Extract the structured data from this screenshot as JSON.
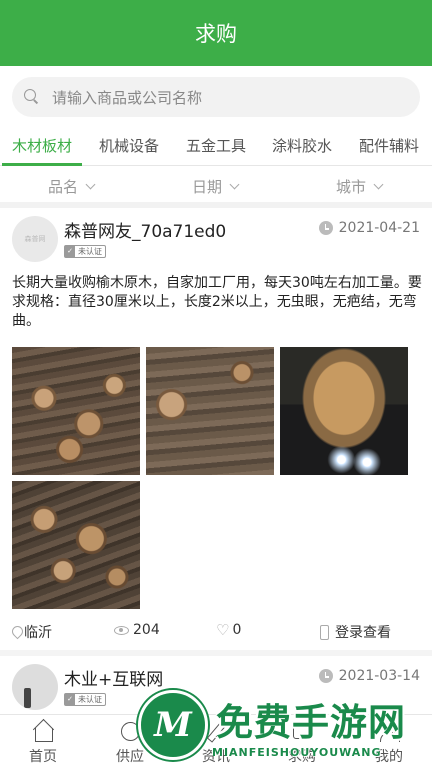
{
  "header": {
    "title": "求购"
  },
  "search": {
    "placeholder": "请输入商品或公司名称"
  },
  "tabs": [
    {
      "label": "木材板材",
      "active": true
    },
    {
      "label": "机械设备"
    },
    {
      "label": "五金工具"
    },
    {
      "label": "涂料胶水"
    },
    {
      "label": "配件辅料"
    }
  ],
  "filters": [
    {
      "label": "品名"
    },
    {
      "label": "日期"
    },
    {
      "label": "城市"
    }
  ],
  "posts": [
    {
      "username": "森普网友_70a71ed0",
      "avatar_text": "森普网",
      "badge": "未认证",
      "date": "2021-04-21",
      "description": "长期大量收购榆木原木，自家加工厂用，每天30吨左右加工量。要求规格：直径30厘米以上，长度2米以上，无虫眼，无疤结，无弯曲。",
      "location": "临沂",
      "views": "204",
      "likes": "0",
      "contact": "登录查看"
    },
    {
      "username": "木业+互联网",
      "badge": "未认证",
      "date": "2021-03-14"
    }
  ],
  "tabbar": [
    {
      "label": "首页",
      "icon": "home-icon"
    },
    {
      "label": "供应",
      "icon": "supply-icon"
    },
    {
      "label": "资讯",
      "icon": "news-icon"
    },
    {
      "label": "求购",
      "icon": "purchase-icon"
    },
    {
      "label": "我的",
      "icon": "user-icon"
    }
  ],
  "watermark": {
    "logo_letter": "M",
    "title": "免费手游网",
    "subtitle": "MIANFEISHOUYOUWANG"
  },
  "colors": {
    "brand": "#3dae48",
    "watermark": "#1a8a4b"
  }
}
